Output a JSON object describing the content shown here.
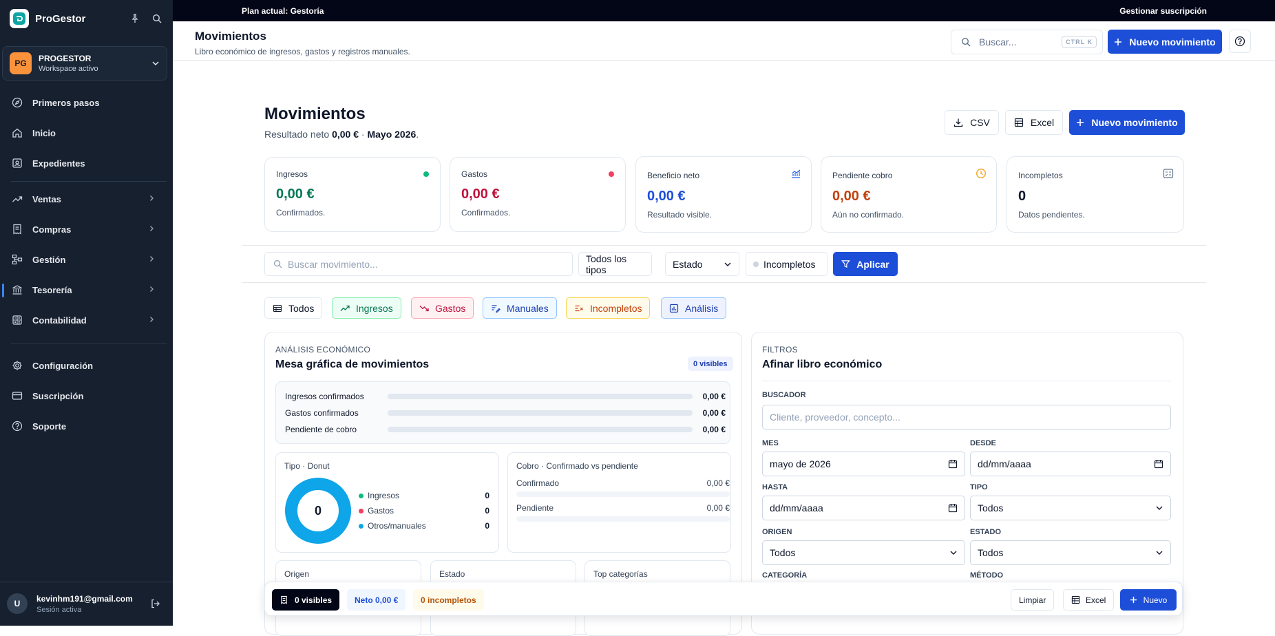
{
  "app": {
    "brand": "ProGestor"
  },
  "workspace": {
    "initials": "PG",
    "name": "PROGESTOR",
    "subtitle": "Workspace activo"
  },
  "sidebar": {
    "items": [
      {
        "label": "Primeros pasos",
        "icon": "compass-icon"
      },
      {
        "label": "Inicio",
        "icon": "home-icon"
      },
      {
        "label": "Expedientes",
        "icon": "folder-icon"
      },
      {
        "label": "Ventas",
        "icon": "trending-up-icon"
      },
      {
        "label": "Compras",
        "icon": "receipt-icon"
      },
      {
        "label": "Gestión",
        "icon": "workflow-icon"
      },
      {
        "label": "Tesorería",
        "icon": "bank-icon"
      },
      {
        "label": "Contabilidad",
        "icon": "calculator-icon"
      },
      {
        "label": "Configuración",
        "icon": "gear-icon"
      },
      {
        "label": "Suscripción",
        "icon": "credit-card-icon"
      },
      {
        "label": "Soporte",
        "icon": "help-circle-icon"
      }
    ],
    "active": "Tesorería"
  },
  "user": {
    "initial": "U",
    "email": "kevinhm191@gmail.com",
    "status": "Sesión activa"
  },
  "topbar": {
    "plan": "Plan actual: Gestoría",
    "manage": "Gestionar suscripción"
  },
  "header": {
    "title": "Movimientos",
    "subtitle": "Libro económico de ingresos, gastos y registros manuales.",
    "search_placeholder": "Buscar...",
    "shortcut": "CTRL K",
    "new_button": "Nuevo movimiento"
  },
  "page": {
    "title": "Movimientos",
    "subtitle_prefix": "Resultado neto",
    "net": "0,00 €",
    "separator": "·",
    "period": "Mayo 2026",
    "period_suffix": ".",
    "csv": "CSV",
    "excel": "Excel",
    "new_button": "Nuevo movimiento"
  },
  "kpis": [
    {
      "label": "Ingresos",
      "value": "0,00 €",
      "sub": "Confirmados."
    },
    {
      "label": "Gastos",
      "value": "0,00 €",
      "sub": "Confirmados."
    },
    {
      "label": "Beneficio neto",
      "value": "0,00 €",
      "sub": "Resultado visible."
    },
    {
      "label": "Pendiente cobro",
      "value": "0,00 €",
      "sub": "Aún no confirmado."
    },
    {
      "label": "Incompletos",
      "value": "0",
      "sub": "Datos pendientes."
    }
  ],
  "filters": {
    "search_placeholder": "Buscar movimiento...",
    "type": "Todos los tipos",
    "state": "Estado",
    "incomplete": "Incompletos",
    "apply": "Aplicar"
  },
  "chips": [
    "Todos",
    "Ingresos",
    "Gastos",
    "Manuales",
    "Incompletos",
    "Análisis"
  ],
  "analysis": {
    "eyebrow": "ANÁLISIS ECONÓMICO",
    "title": "Mesa gráfica de movimientos",
    "badge": "0 visibles",
    "bars": [
      {
        "label": "Ingresos confirmados",
        "value": "0,00 €",
        "fraction": 0
      },
      {
        "label": "Gastos confirmados",
        "value": "0,00 €",
        "fraction": 0
      },
      {
        "label": "Pendiente de cobro",
        "value": "0,00 €",
        "fraction": 0
      }
    ],
    "donut": {
      "title": "Tipo · Donut",
      "total": "0",
      "legend": [
        {
          "label": "Ingresos",
          "value": "0",
          "color": "#10b981"
        },
        {
          "label": "Gastos",
          "value": "0",
          "color": "#f43f5e"
        },
        {
          "label": "Otros/manuales",
          "value": "0",
          "color": "#0ea5e9"
        }
      ]
    },
    "cobro": {
      "title": "Cobro · Confirmado vs pendiente",
      "rows": [
        {
          "label": "Confirmado",
          "value": "0,00 €",
          "fraction": 0
        },
        {
          "label": "Pendiente",
          "value": "0,00 €",
          "fraction": 0
        }
      ]
    },
    "bottom_cards": [
      "Origen",
      "Estado",
      "Top categorías"
    ]
  },
  "filters_panel": {
    "eyebrow": "FILTROS",
    "title": "Afinar libro económico",
    "buscador_label": "BUSCADOR",
    "buscador_placeholder": "Cliente, proveedor, concepto...",
    "mes_label": "MES",
    "mes_value": "mayo de 2026",
    "desde_label": "DESDE",
    "desde_value": "dd/mm/aaaa",
    "hasta_label": "HASTA",
    "hasta_value": "dd/mm/aaaa",
    "tipo_label": "TIPO",
    "tipo_value": "Todos",
    "origen_label": "ORIGEN",
    "origen_value": "Todos",
    "estado_label": "ESTADO",
    "estado_value": "Todos",
    "categoria_label": "CATEGORÍA",
    "metodo_label": "MÉTODO"
  },
  "floater": {
    "visibles": "0 visibles",
    "neto": "Neto 0,00 €",
    "incompletos": "0 incompletos",
    "limpiar": "Limpiar",
    "excel": "Excel",
    "nuevo": "Nuevo"
  },
  "colors": {
    "primary": "#1d4ed8",
    "sidebar": "#16202f",
    "income": "#047857",
    "expense": "#be123c",
    "pending": "#c2410c"
  }
}
